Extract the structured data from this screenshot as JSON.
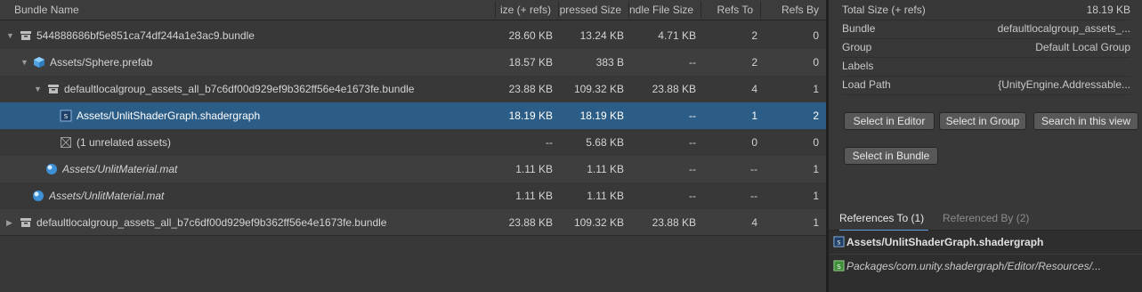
{
  "columns": [
    "Bundle Name",
    "ize (+ refs)",
    "pressed Size",
    "ndle File Size",
    "Refs To",
    "Refs By"
  ],
  "rows": [
    {
      "name": "544888686bf5e851ca74df244a1e3ac9.bundle",
      "size": "28.60 KB",
      "compressed": "13.24 KB",
      "bundle_file": "4.71 KB",
      "refs_to": "2",
      "refs_by": "0",
      "icon": "bundle-icon",
      "arrow": "expanded-arrow"
    },
    {
      "name": "Assets/Sphere.prefab",
      "size": "18.57 KB",
      "compressed": "383 B",
      "bundle_file": "--",
      "refs_to": "2",
      "refs_by": "0",
      "icon": "prefab-icon",
      "arrow": "expanded-arrow"
    },
    {
      "name": "defaultlocalgroup_assets_all_b7c6df00d929ef9b362ff56e4e1673fe.bundle",
      "size": "23.88 KB",
      "compressed": "109.32 KB",
      "bundle_file": "23.88 KB",
      "refs_to": "4",
      "refs_by": "1",
      "icon": "bundle-icon",
      "arrow": "expanded-arrow"
    },
    {
      "name": "Assets/UnlitShaderGraph.shadergraph",
      "size": "18.19 KB",
      "compressed": "18.19 KB",
      "bundle_file": "--",
      "refs_to": "1",
      "refs_by": "2",
      "icon": "shadergraph-icon",
      "selected": true
    },
    {
      "name": "(1 unrelated assets)",
      "size": "--",
      "compressed": "5.68 KB",
      "bundle_file": "--",
      "refs_to": "0",
      "refs_by": "0",
      "icon": "unrelated-icon"
    },
    {
      "name": "Assets/UnlitMaterial.mat",
      "size": "1.11 KB",
      "compressed": "1.11 KB",
      "bundle_file": "--",
      "refs_to": "--",
      "refs_by": "1",
      "icon": "material-icon",
      "italic": true
    },
    {
      "name": "Assets/UnlitMaterial.mat",
      "size": "1.11 KB",
      "compressed": "1.11 KB",
      "bundle_file": "--",
      "refs_to": "--",
      "refs_by": "1",
      "icon": "material-icon",
      "italic": true
    },
    {
      "name": "defaultlocalgroup_assets_all_b7c6df00d929ef9b362ff56e4e1673fe.bundle",
      "size": "23.88 KB",
      "compressed": "109.32 KB",
      "bundle_file": "23.88 KB",
      "refs_to": "4",
      "refs_by": "1",
      "icon": "bundle-icon",
      "arrow": "collapsed-arrow"
    }
  ],
  "inspector": {
    "properties": [
      {
        "key": "Total Size (+ refs)",
        "value": "18.19 KB"
      },
      {
        "key": "Bundle",
        "value": "defaultlocalgroup_assets_..."
      },
      {
        "key": "Group",
        "value": "Default Local Group"
      },
      {
        "key": "Labels",
        "value": ""
      },
      {
        "key": "Load Path",
        "value": "{UnityEngine.Addressable..."
      }
    ],
    "buttons": {
      "select_in_editor": "Select in Editor",
      "select_in_group": "Select in Group",
      "search_in_view": "Search in this view",
      "select_in_bundle": "Select in Bundle"
    },
    "tabs": {
      "references_to": "References To (1)",
      "referenced_by": "Referenced By (2)"
    },
    "references": [
      {
        "text": "Assets/UnlitShaderGraph.shadergraph",
        "icon": "shadergraph-icon"
      },
      {
        "text": "Packages/com.unity.shadergraph/Editor/Resources/...",
        "icon": "shader-icon"
      }
    ]
  },
  "colors": {
    "selection": "#2c5d87",
    "background": "#383838",
    "alt_row": "#3e3e3e",
    "tab_accent": "#5d9ad6"
  }
}
